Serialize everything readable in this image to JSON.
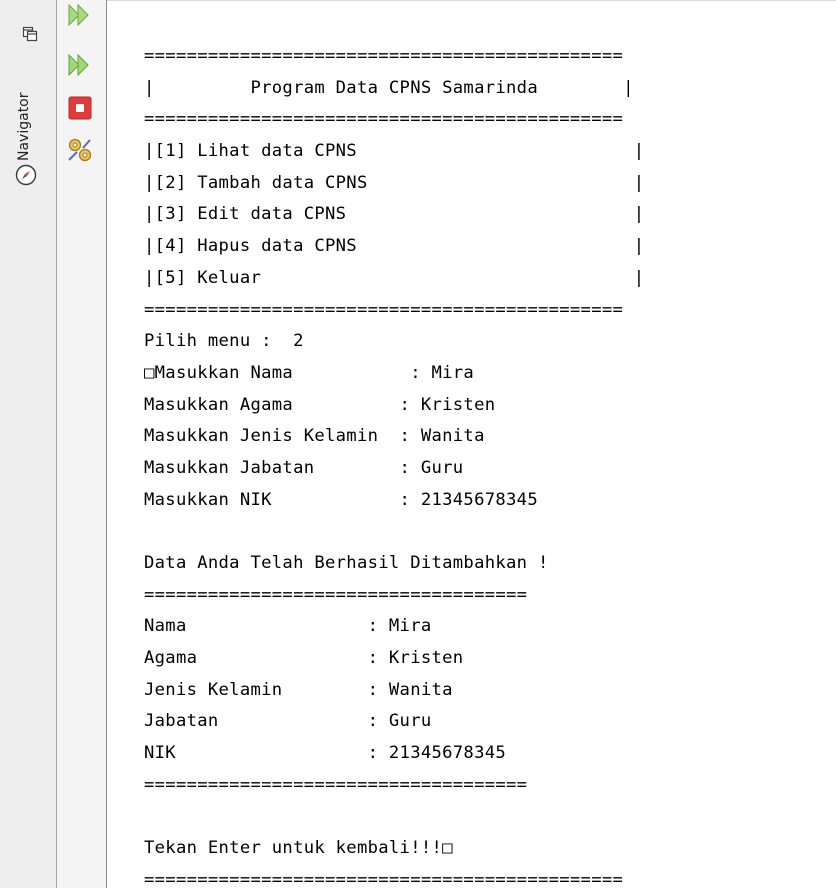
{
  "navigator": {
    "label": "Navigator",
    "restore_icon": "restore-window-icon",
    "tab_icon": "compass-icon"
  },
  "toolbar": {
    "buttons": [
      {
        "icon": "rerun-icon"
      },
      {
        "icon": "rerun-with-options-icon"
      },
      {
        "icon": "stop-icon"
      },
      {
        "icon": "settings-icon"
      }
    ],
    "colors": {
      "rerun": "#5fbf2a",
      "stop": "#e0393b",
      "settings": "#d9a520"
    }
  },
  "console": {
    "lines": [
      "=============================================",
      "|         Program Data CPNS Samarinda        |",
      "=============================================",
      "|[1] Lihat data CPNS                          |",
      "|[2] Tambah data CPNS                         |",
      "|[3] Edit data CPNS                           |",
      "|[4] Hapus data CPNS                          |",
      "|[5] Keluar                                   |",
      "=============================================",
      "Pilih menu :  2",
      "□Masukkan Nama           : Mira",
      "Masukkan Agama          : Kristen",
      "Masukkan Jenis Kelamin  : Wanita",
      "Masukkan Jabatan        : Guru",
      "Masukkan NIK            : 21345678345",
      "",
      "Data Anda Telah Berhasil Ditambahkan !",
      "====================================",
      "Nama                 : Mira",
      "Agama                : Kristen",
      "Jenis Kelamin        : Wanita",
      "Jabatan              : Guru",
      "NIK                  : 21345678345",
      "====================================",
      "",
      "Tekan Enter untuk kembali!!!□",
      "============================================="
    ]
  }
}
